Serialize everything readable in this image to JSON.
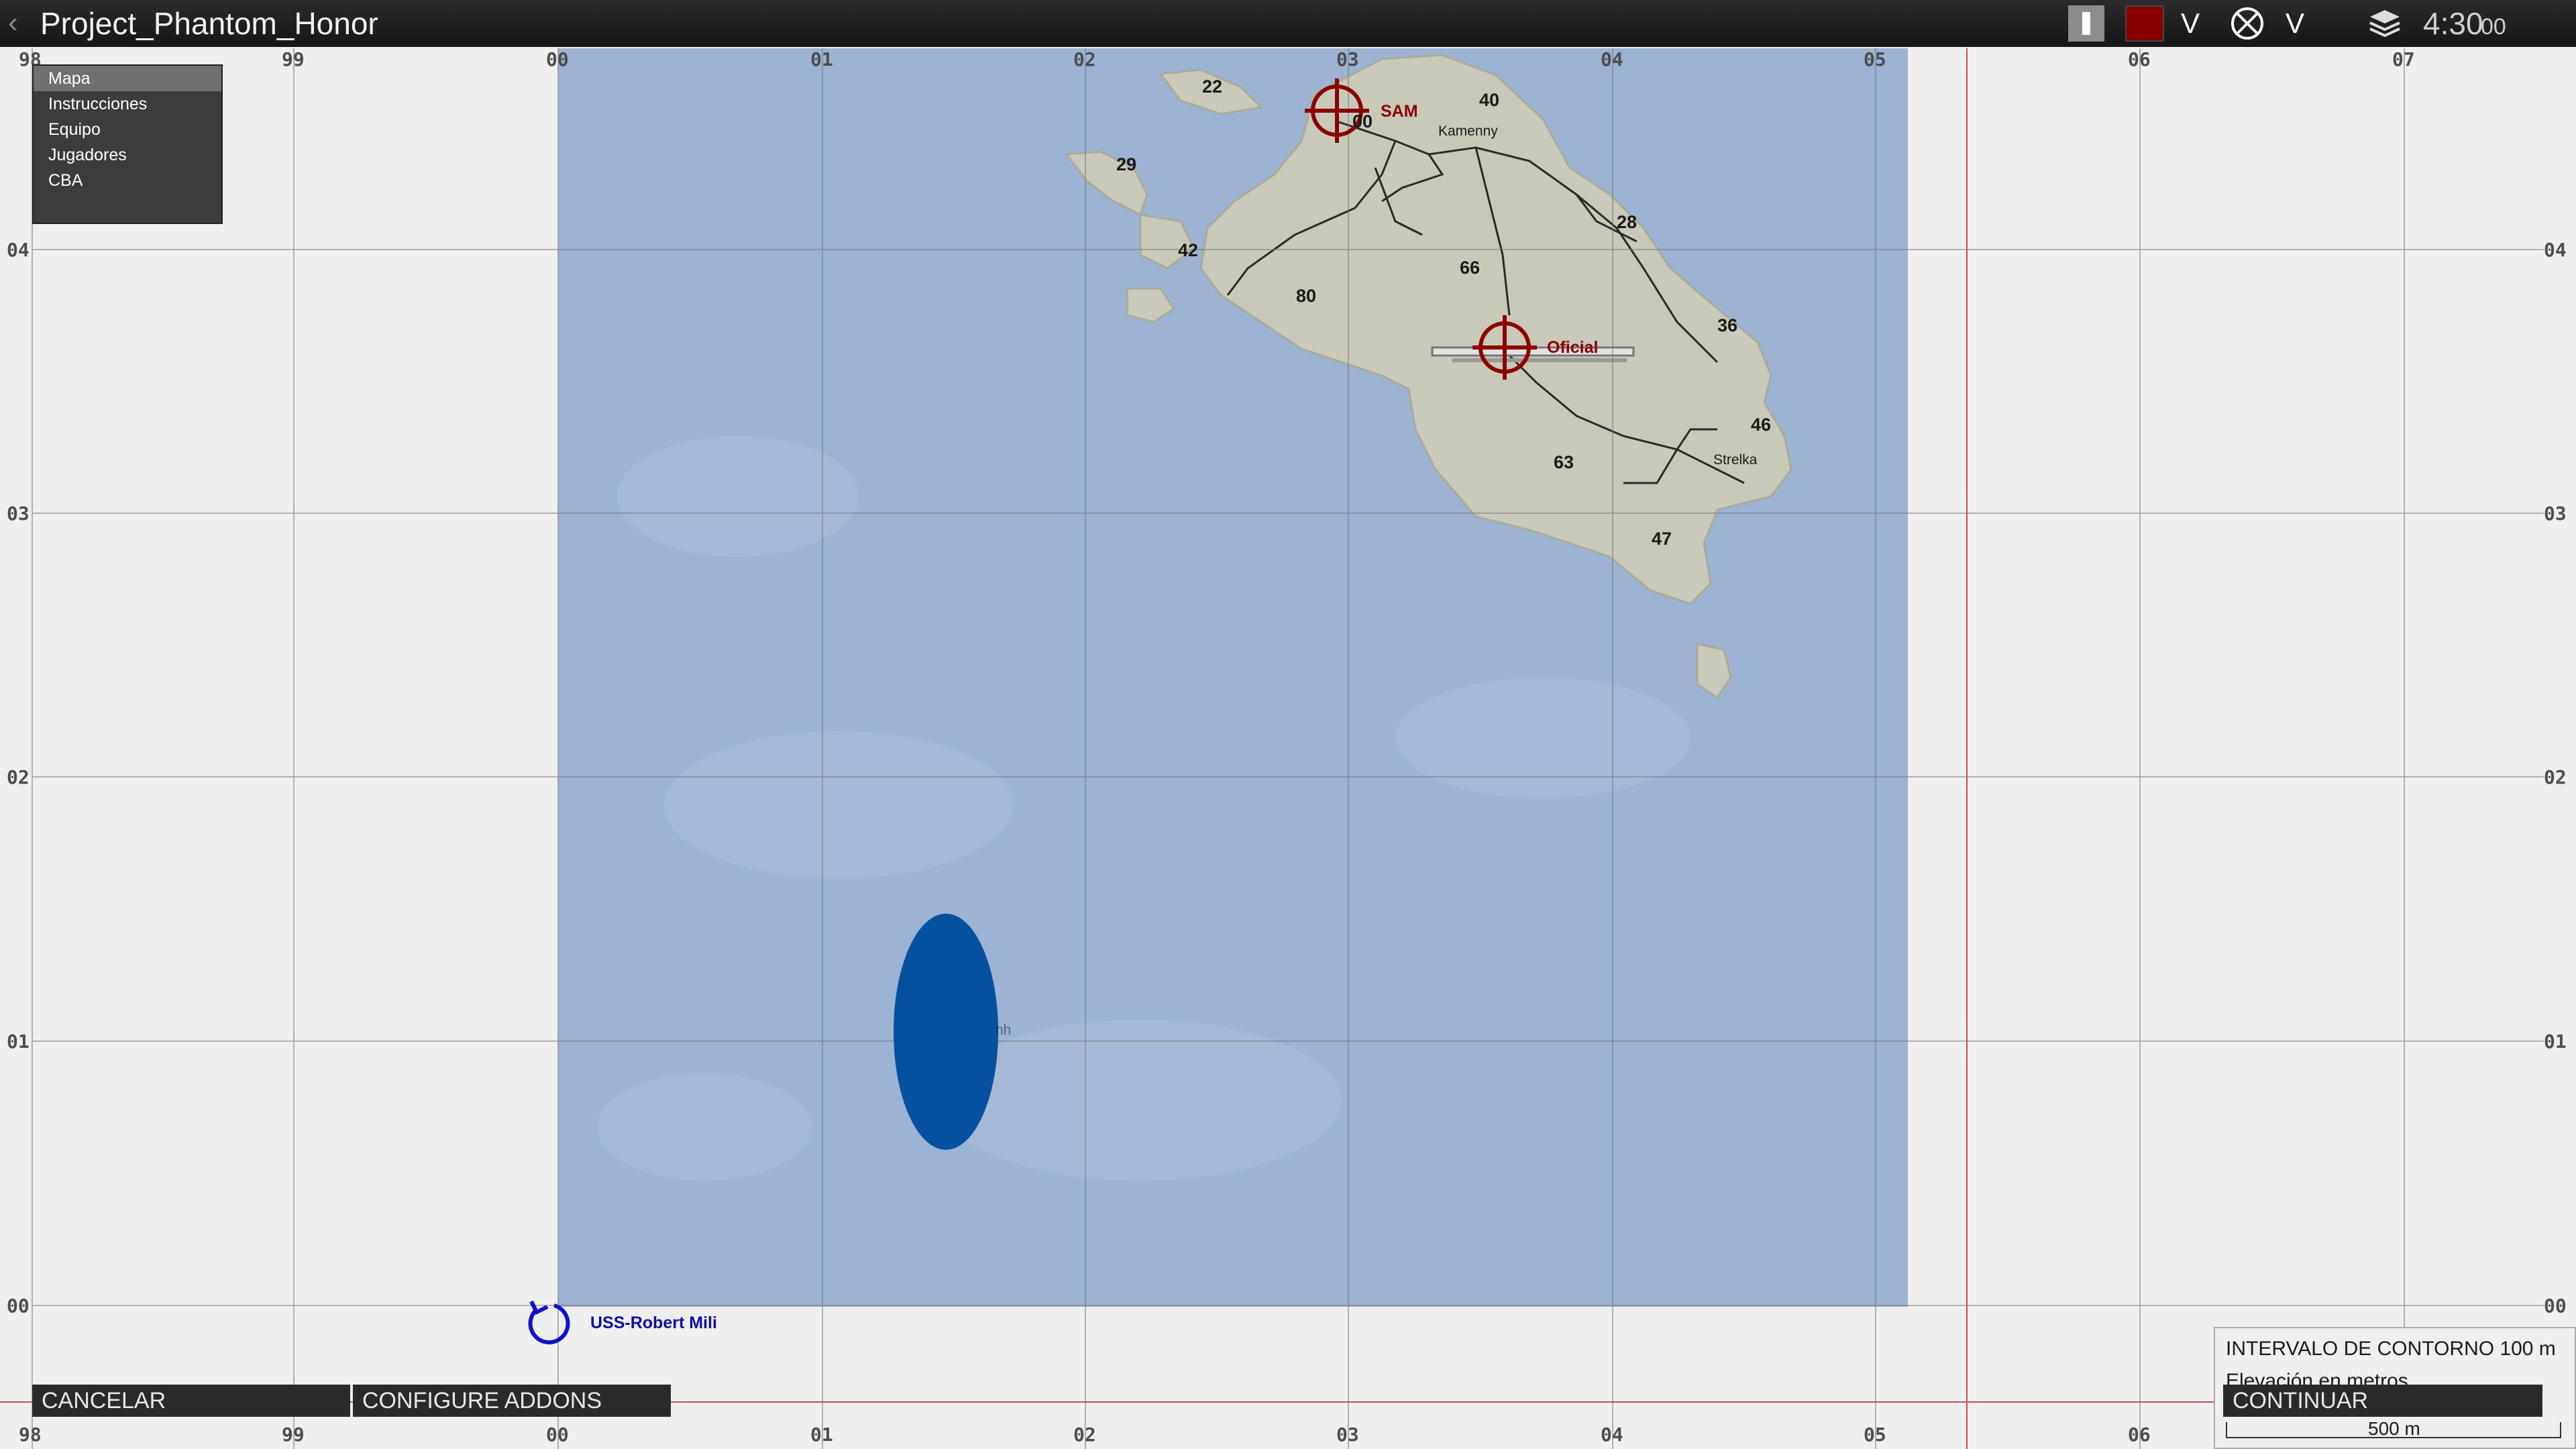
{
  "topbar": {
    "title": "Project_Phantom_Honor",
    "back_glyph": "‹",
    "dropdown_glyph": "V",
    "clock": "4:30",
    "clock_seconds": "00",
    "icons": [
      "chevron-left-icon",
      "pause-icon",
      "red-faction-icon",
      "circle-x-marker-icon",
      "layers-icon"
    ],
    "faction_color": "#8a0000"
  },
  "side_menu": {
    "items": [
      {
        "label": "Mapa"
      },
      {
        "label": "Instrucciones"
      },
      {
        "label": "Equipo"
      },
      {
        "label": "Jugadores"
      },
      {
        "label": "CBA"
      }
    ],
    "selected": "Mapa"
  },
  "grid": {
    "x_labels": [
      "98",
      "99",
      "00",
      "01",
      "02",
      "03",
      "04",
      "05",
      "06",
      "07"
    ],
    "y_labels": [
      "04",
      "03",
      "02",
      "01",
      "00"
    ]
  },
  "map": {
    "water_color": "#9db3d3",
    "land_color": "#c8c9b8",
    "elevations": [
      "22",
      "40",
      "00",
      "29",
      "28",
      "42",
      "66",
      "80",
      "36",
      "46",
      "63",
      "47"
    ],
    "towns": [
      "Kamenny",
      "Strelka",
      "nh"
    ],
    "markers": [
      {
        "label": "SAM",
        "icon": "target-crosshair-icon",
        "color": "#8c0000"
      },
      {
        "label": "Oficial",
        "icon": "target-crosshair-icon",
        "color": "#8c0000"
      }
    ],
    "zone_color": "#0650a0",
    "ship": {
      "label": "USS-Robert Mili",
      "icon": "rotate-arrow-icon",
      "color": "#1010a0"
    }
  },
  "buttons": {
    "cancel": "CANCELAR",
    "configure_addons": "CONFIGURE ADDONS",
    "continue": "CONTINUAR"
  },
  "legend": {
    "contour_interval": "INTERVALO DE CONTORNO 100 m",
    "elevation_units": "Elevación en metros",
    "scale": "500 m"
  }
}
